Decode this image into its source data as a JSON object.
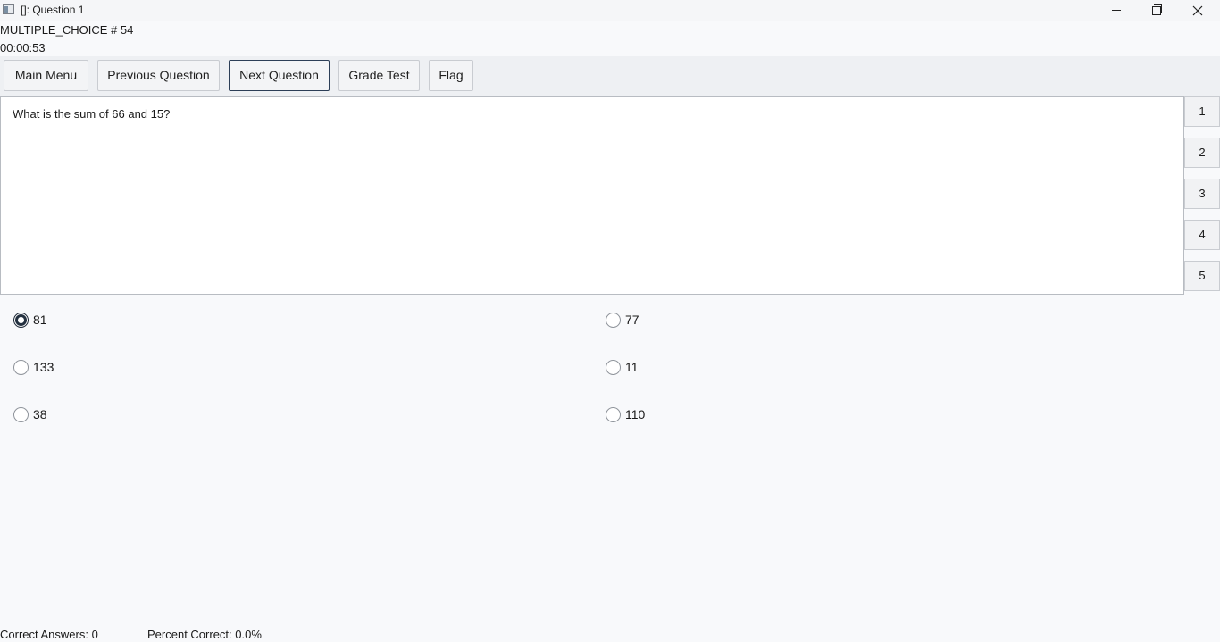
{
  "window": {
    "title": "[]: Question 1",
    "controls": [
      "minimize-icon",
      "maximize-icon",
      "close-icon"
    ]
  },
  "header": {
    "question_type": "MULTIPLE_CHOICE # 54",
    "timer": "00:00:53"
  },
  "toolbar": {
    "main_menu": "Main Menu",
    "previous": "Previous Question",
    "next": "Next Question",
    "grade": "Grade Test",
    "flag": "Flag"
  },
  "question": {
    "text": "What is the sum of 66 and 15?"
  },
  "question_nav": [
    "1",
    "2",
    "3",
    "4",
    "5"
  ],
  "options": [
    {
      "label": "81",
      "selected": true
    },
    {
      "label": "77",
      "selected": false
    },
    {
      "label": "133",
      "selected": false
    },
    {
      "label": "11",
      "selected": false
    },
    {
      "label": "38",
      "selected": false
    },
    {
      "label": "110",
      "selected": false
    }
  ],
  "footer": {
    "correct_answers": "Correct Answers: 0",
    "percent_correct": "Percent Correct: 0.0%"
  }
}
